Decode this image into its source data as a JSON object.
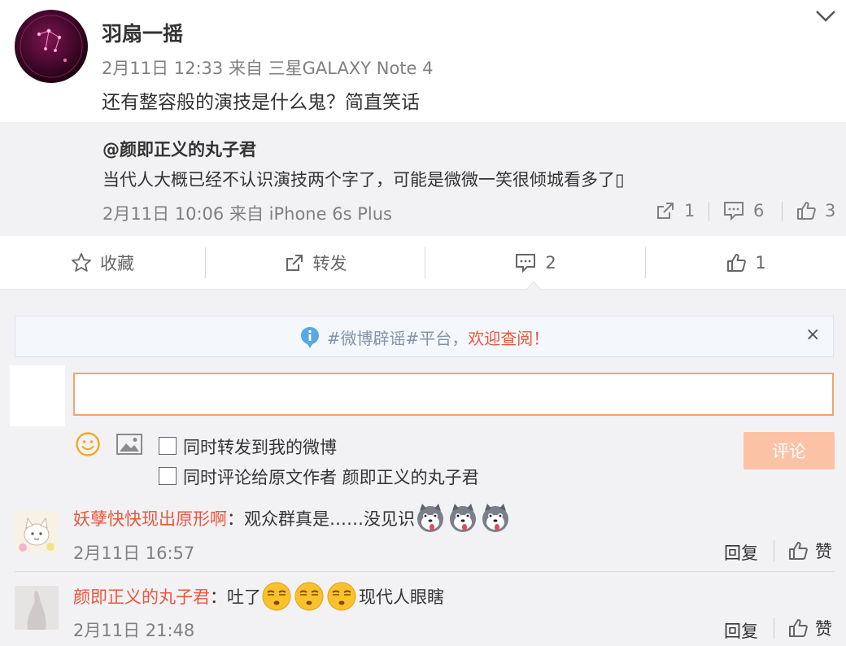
{
  "post": {
    "author": "羽扇一摇",
    "time": "2月11日 12:33",
    "via_label": "来自",
    "source": "三星GALAXY Note 4",
    "text": "还有整容般的演技是什么鬼？简直笑话"
  },
  "repost": {
    "author": "@颜即正义的丸子君",
    "text": "当代人大概已经不认识演技两个字了，可能是微微一笑很倾城看多了▯",
    "time": "2月11日 10:06",
    "via_label": "来自",
    "source": "iPhone 6s Plus",
    "share_count": "1",
    "comment_count": "6",
    "like_count": "3"
  },
  "actions": {
    "favorite": "收藏",
    "forward": "转发",
    "comment_count": "2",
    "like_count": "1"
  },
  "notice": {
    "text": "#微博辟谣#平台，",
    "highlight": "欢迎查阅！",
    "close": "×"
  },
  "composer": {
    "input_value": "",
    "option_forward": "同时转发到我的微博",
    "option_comment_original": "同时评论给原文作者 颜即正义的丸子君",
    "submit": "评论"
  },
  "comments": [
    {
      "name": "妖孽快快现出原形啊",
      "separator": "：",
      "text": "观众群真是……没见识",
      "text_after": "",
      "time": "2月11日 16:57",
      "reply": "回复",
      "like": "赞"
    },
    {
      "name": "颜即正义的丸子君",
      "separator": "：",
      "text": "吐了",
      "text_after": "现代人眼瞎",
      "time": "2月11日 21:48",
      "reply": "回复",
      "like": "赞"
    }
  ],
  "colors": {
    "accent": "#e8573d",
    "submit_bg": "#fbc2a6",
    "input_border": "#f0a374",
    "panel_bg": "#f2f2f5"
  }
}
